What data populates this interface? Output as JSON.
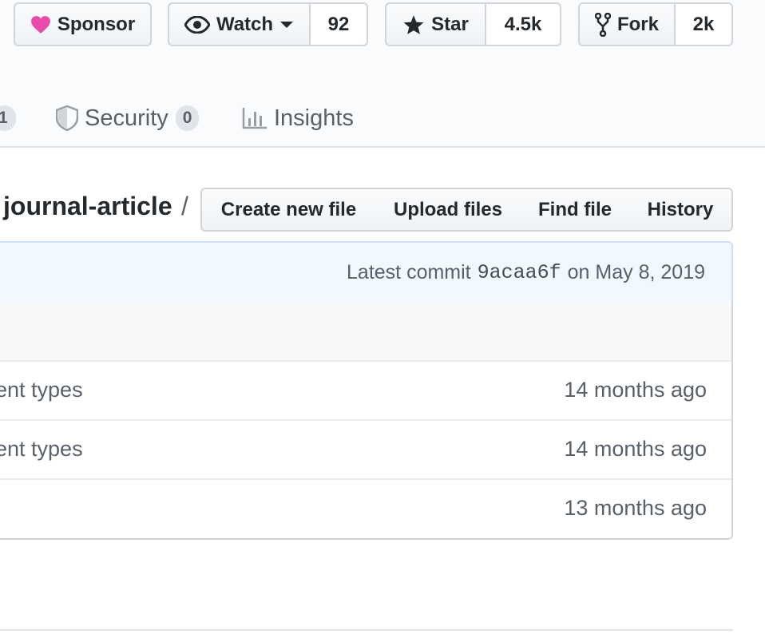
{
  "repo_actions": {
    "sponsor_label": "Sponsor",
    "watch_label": "Watch",
    "watch_count": "92",
    "star_label": "Star",
    "star_count": "4.5k",
    "fork_label": "Fork",
    "fork_count": "2k"
  },
  "nav": {
    "partial_count": "1",
    "security_label": "Security",
    "security_count": "0",
    "insights_label": "Insights"
  },
  "breadcrumb": {
    "current_dir": "journal-article",
    "separator": "/"
  },
  "file_actions": {
    "create_label": "Create new file",
    "upload_label": "Upload files",
    "find_label": "Find file",
    "history_label": "History"
  },
  "commit": {
    "prefix": "Latest commit",
    "sha": "9acaa6f",
    "date": "on May 8, 2019"
  },
  "files": [
    {
      "message": "ent types",
      "age": "14 months ago"
    },
    {
      "message": "ent types",
      "age": "14 months ago"
    },
    {
      "message": ".",
      "age": "13 months ago"
    }
  ],
  "colors": {
    "sponsor_heart": "#ea4aaa",
    "commit_bar_bg": "#f1f8ff",
    "muted_text": "#586069"
  }
}
